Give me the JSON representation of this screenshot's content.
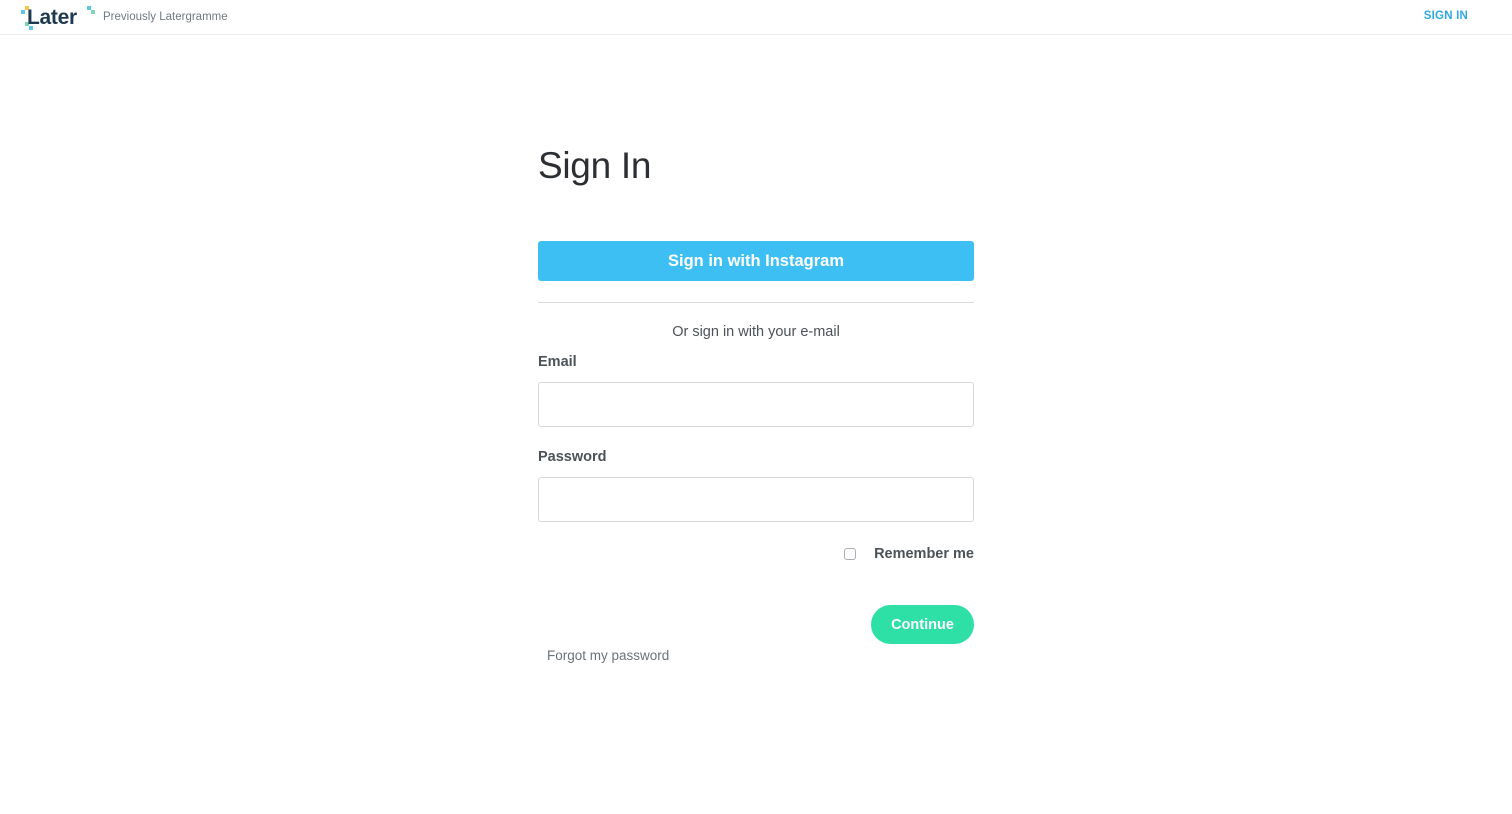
{
  "header": {
    "logo_text": "Later",
    "tagline": "Previously Latergramme",
    "signin_link": "SIGN IN"
  },
  "colors": {
    "brand_navy": "#1e3a50",
    "link_blue": "#2fa9e0",
    "instagram_button": "#3dbff3",
    "continue_button": "#2ee0a6"
  },
  "form": {
    "title": "Sign In",
    "instagram_button": "Sign in with Instagram",
    "or_text": "Or sign in with your e-mail",
    "email_label": "Email",
    "email_value": "",
    "password_label": "Password",
    "password_value": "",
    "remember_label": "Remember me",
    "remember_checked": false,
    "continue_button": "Continue",
    "forgot_link": "Forgot my password"
  }
}
